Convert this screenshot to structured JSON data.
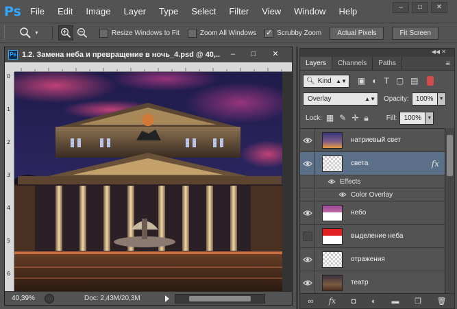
{
  "app": {
    "logo": "Ps",
    "menu": [
      "File",
      "Edit",
      "Image",
      "Layer",
      "Type",
      "Select",
      "Filter",
      "View",
      "Window",
      "Help"
    ],
    "window_controls": [
      "minimize-icon",
      "restore-icon",
      "close-icon"
    ]
  },
  "options": {
    "checkboxes": [
      {
        "label": "Resize Windows to Fit",
        "checked": false
      },
      {
        "label": "Zoom All Windows",
        "checked": false
      },
      {
        "label": "Scrubby Zoom",
        "checked": true
      }
    ],
    "buttons": [
      "Actual Pixels",
      "Fit Screen"
    ]
  },
  "document": {
    "title": "1.2. Замена неба и превращение в ночь_4.psd @ 40,...",
    "ruler_left_ticks": [
      "0",
      "1",
      "2",
      "3",
      "4",
      "5",
      "6"
    ],
    "zoom": "40,39%",
    "doc_info": "Doc: 2,43M/20,3M"
  },
  "layers_panel": {
    "tabs": [
      "Layers",
      "Channels",
      "Paths"
    ],
    "active_tab": "Layers",
    "kind_filter": "Kind",
    "blend_mode": "Overlay",
    "opacity_label": "Opacity:",
    "opacity": "100%",
    "lock_label": "Lock:",
    "fill_label": "Fill:",
    "fill": "100%",
    "layers": [
      {
        "name": "натриевый свет",
        "visible": true,
        "selected": false,
        "thumb": "sodium",
        "fx": false
      },
      {
        "name": "света",
        "visible": true,
        "selected": true,
        "thumb": "checker",
        "fx": true
      },
      {
        "name": "небо",
        "visible": true,
        "selected": false,
        "thumb": "sky",
        "fx": false
      },
      {
        "name": "выделение неба",
        "visible": false,
        "selected": false,
        "thumb": "red",
        "fx": false
      },
      {
        "name": "отражения",
        "visible": true,
        "selected": false,
        "thumb": "checker",
        "fx": false
      },
      {
        "name": "театр",
        "visible": true,
        "selected": false,
        "thumb": "theatre",
        "fx": false
      }
    ],
    "effects_label": "Effects",
    "effect_item": "Color Overlay",
    "fx_label": "fx"
  },
  "colors": {
    "ui_bg": "#535353",
    "selection": "#5b6f89",
    "ps_blue": "#31a8ff"
  }
}
